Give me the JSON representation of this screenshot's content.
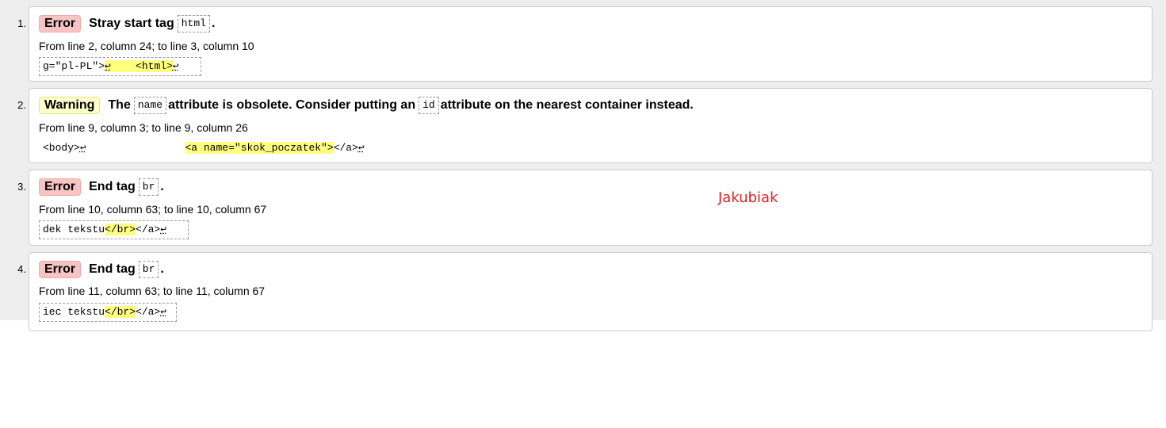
{
  "messages": [
    {
      "index": "1.",
      "type": "Error",
      "title_parts": [
        "Stray start tag",
        "html",
        "."
      ],
      "location": "From line 2, column 24; to line 3, column 10",
      "extract": {
        "pre": "g=\"pl-PL\">",
        "lf1": "↩",
        "mid": "    <html>",
        "lf2": "↩",
        "post": "   "
      }
    },
    {
      "index": "2.",
      "type": "Warning",
      "title_parts": [
        "The",
        "name",
        "attribute is obsolete. Consider putting an",
        "id",
        "attribute on the nearest container instead."
      ],
      "location": "From line 9, column 3; to line 9, column 26",
      "extract": {
        "pre": "<body>",
        "lf1": "↩",
        "gap": "                ",
        "hl": "<a name=\"skok_poczatek\">",
        "post": "</a>",
        "lf2": "↩"
      }
    },
    {
      "index": "3.",
      "type": "Error",
      "title_parts": [
        "End tag",
        "br",
        "."
      ],
      "location": "From line 10, column 63; to line 10, column 67",
      "extract": {
        "pre": "dek tekstu",
        "hl": "</br>",
        "post": "</a>",
        "lf": "↩",
        "tail": "   "
      }
    },
    {
      "index": "4.",
      "type": "Error",
      "title_parts": [
        "End tag",
        "br",
        "."
      ],
      "location": "From line 11, column 63; to line 11, column 67",
      "extract": {
        "pre": "iec tekstu",
        "hl": "</br>",
        "post": "</a>",
        "lf": "↩",
        "tail": " "
      }
    }
  ],
  "annotation": "Jakubiak",
  "colors": {
    "error_badge": "#f7c4c4",
    "warning_badge": "#ffffcc",
    "highlight": "#ffff80",
    "annotation": "#dd2222"
  }
}
